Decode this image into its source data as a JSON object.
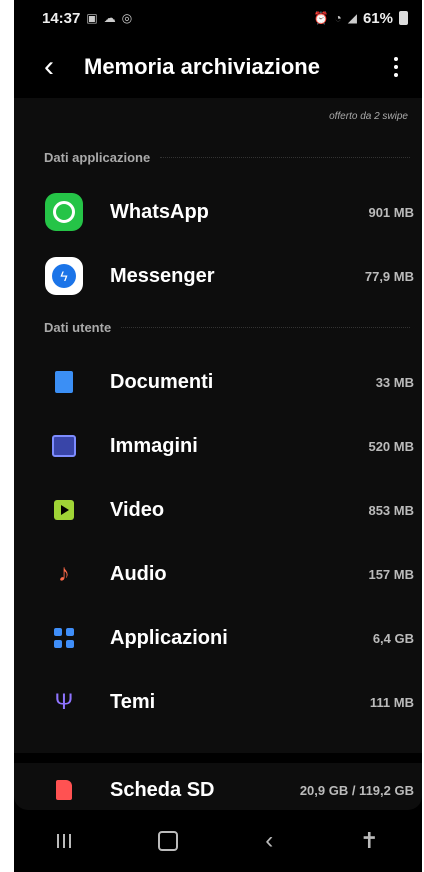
{
  "status": {
    "time": "14:37",
    "battery": "61%"
  },
  "appbar": {
    "title": "Memoria archiviazione"
  },
  "offer": "offerto da 2 swipe",
  "sections": {
    "app_data": "Dati applicazione",
    "user_data": "Dati utente"
  },
  "apps": [
    {
      "name": "WhatsApp",
      "size": "901 MB",
      "icon": "whatsapp-icon"
    },
    {
      "name": "Messenger",
      "size": "77,9 MB",
      "icon": "messenger-icon"
    }
  ],
  "user": [
    {
      "name": "Documenti",
      "size": "33 MB",
      "icon": "document-icon"
    },
    {
      "name": "Immagini",
      "size": "520 MB",
      "icon": "image-icon"
    },
    {
      "name": "Video",
      "size": "853 MB",
      "icon": "video-icon"
    },
    {
      "name": "Audio",
      "size": "157 MB",
      "icon": "music-note-icon"
    },
    {
      "name": "Applicazioni",
      "size": "6,4 GB",
      "icon": "apps-grid-icon"
    },
    {
      "name": "Temi",
      "size": "111 MB",
      "icon": "brush-icon"
    }
  ],
  "sdcard": {
    "name": "Scheda SD",
    "size": "20,9 GB / 119,2 GB",
    "icon": "sd-card-icon"
  },
  "colors": {
    "whatsapp": "#25c447",
    "messenger": "#1b74e8",
    "background": "#0d0d0d"
  }
}
